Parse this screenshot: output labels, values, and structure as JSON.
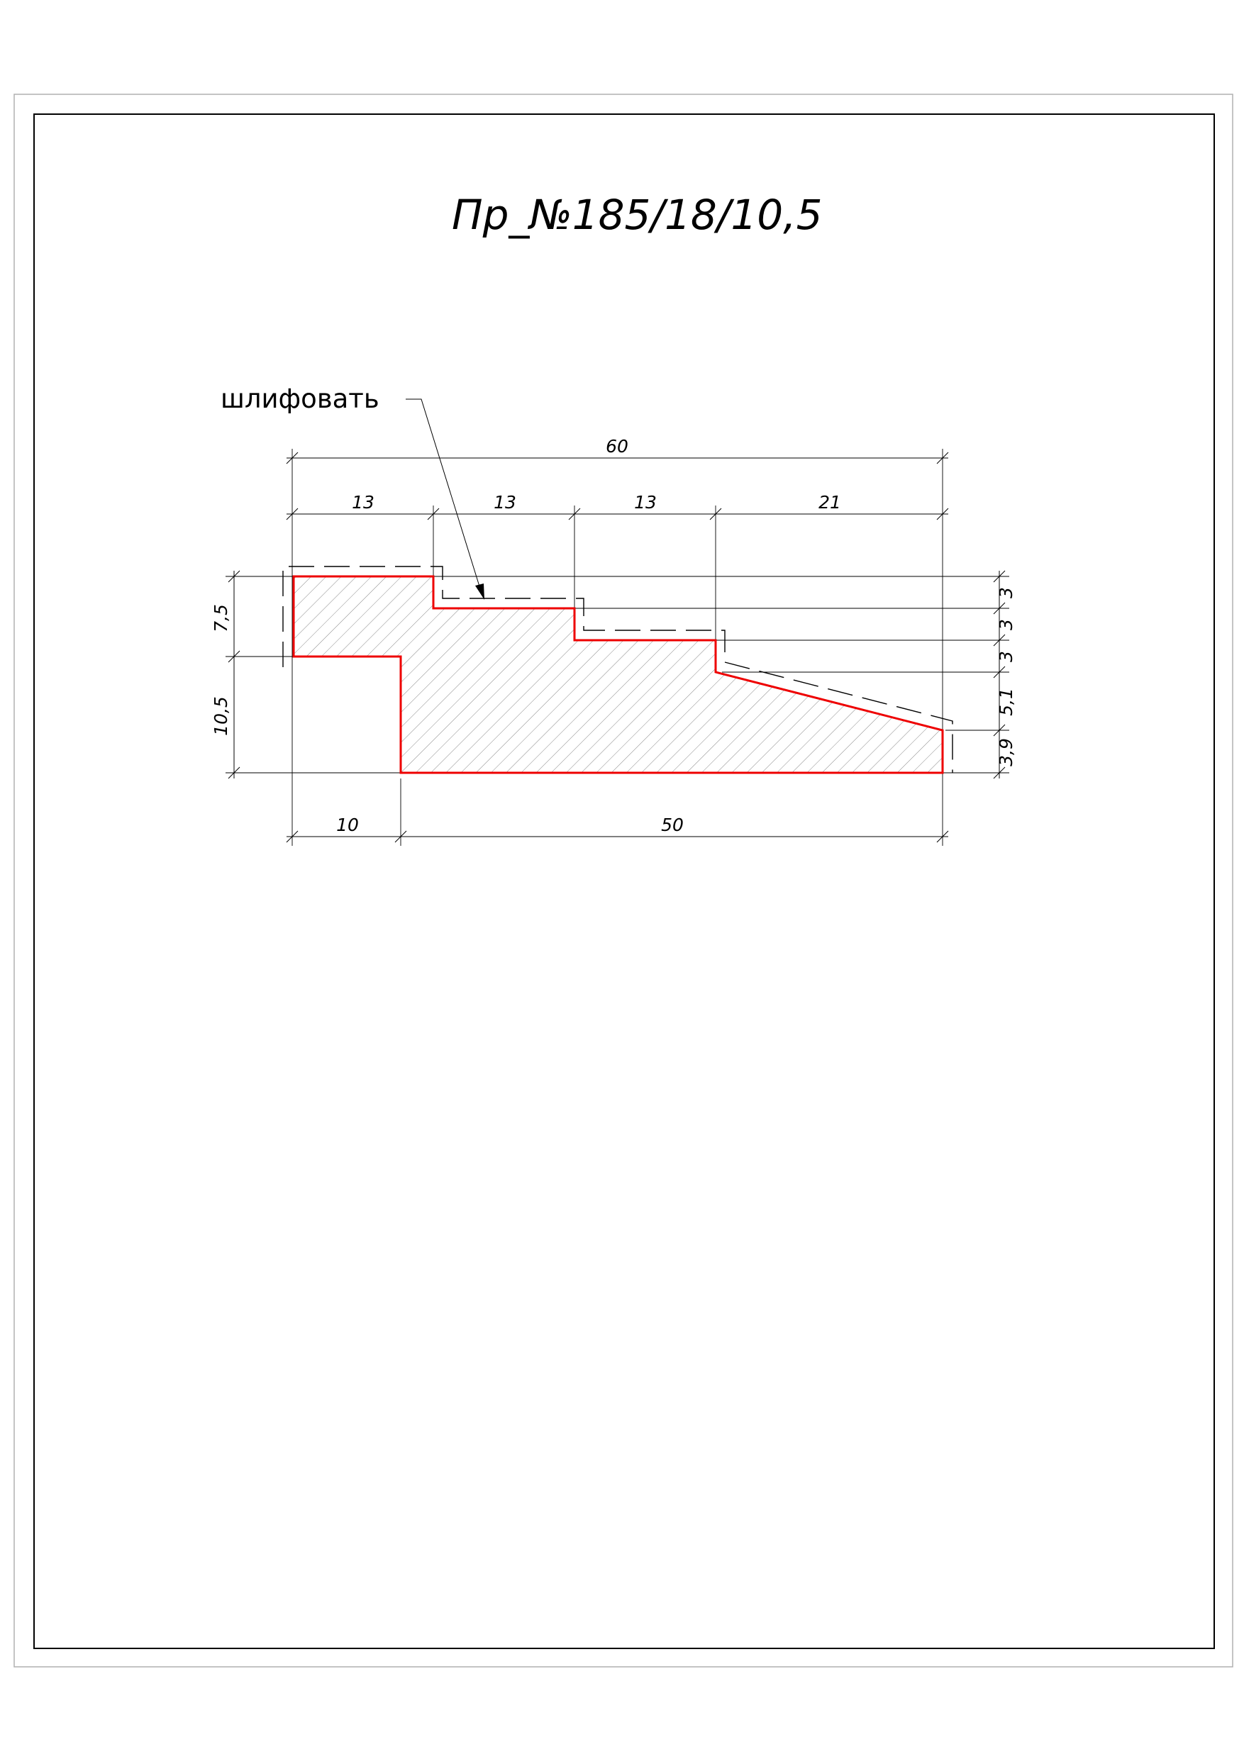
{
  "drawing": {
    "title": "Пр_№185/18/10,5",
    "note": "шлифовать"
  },
  "dimensions": {
    "overall_width": "60",
    "step_1": "13",
    "step_2": "13",
    "step_3": "13",
    "slope_width": "21",
    "bottom_left": "10",
    "bottom_right": "50",
    "height_upper_left": "7,5",
    "height_lower_left": "10,5",
    "right_h1": "3",
    "right_h2": "3",
    "right_h3": "3",
    "right_h4": "5,1",
    "right_h5": "3,9"
  },
  "colors": {
    "profile_outline": "#ee0000",
    "lines": "#000000"
  }
}
